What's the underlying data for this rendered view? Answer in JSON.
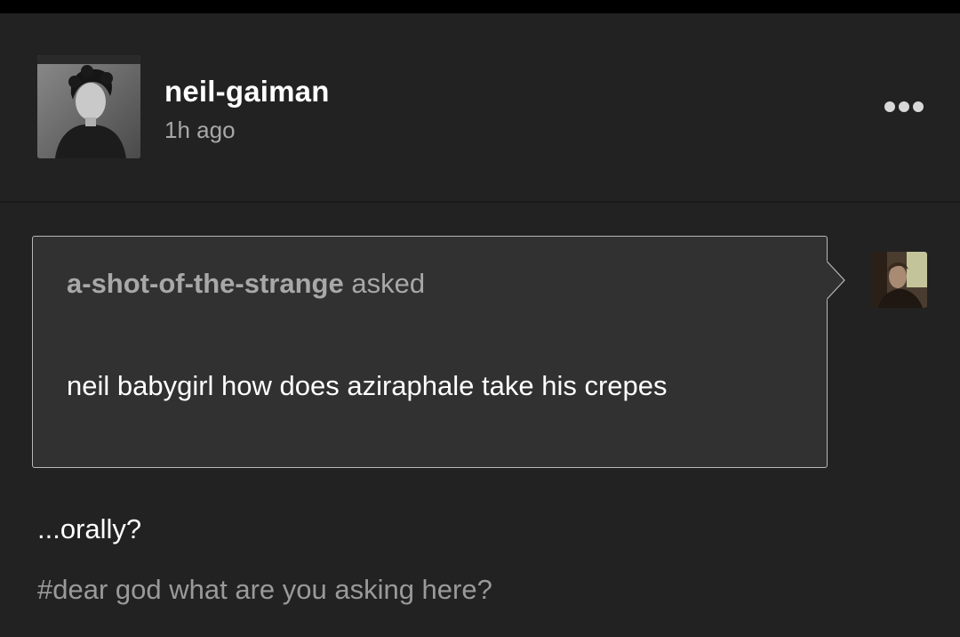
{
  "post": {
    "username": "neil-gaiman",
    "timestamp": "1h ago",
    "avatar_icon": "author-avatar",
    "menu_icon": "more-options-icon"
  },
  "ask": {
    "asker": "a-shot-of-the-strange",
    "verb": "asked",
    "question": "neil babygirl how does aziraphale take his crepes",
    "asker_avatar_icon": "asker-avatar"
  },
  "answer": {
    "text": "...orally?"
  },
  "tags": [
    "#dear god what are you asking here?"
  ],
  "colors": {
    "background": "#222222",
    "ask_box": "#313131",
    "primary_text": "#ffffff",
    "secondary_text": "#a8a8a8"
  }
}
